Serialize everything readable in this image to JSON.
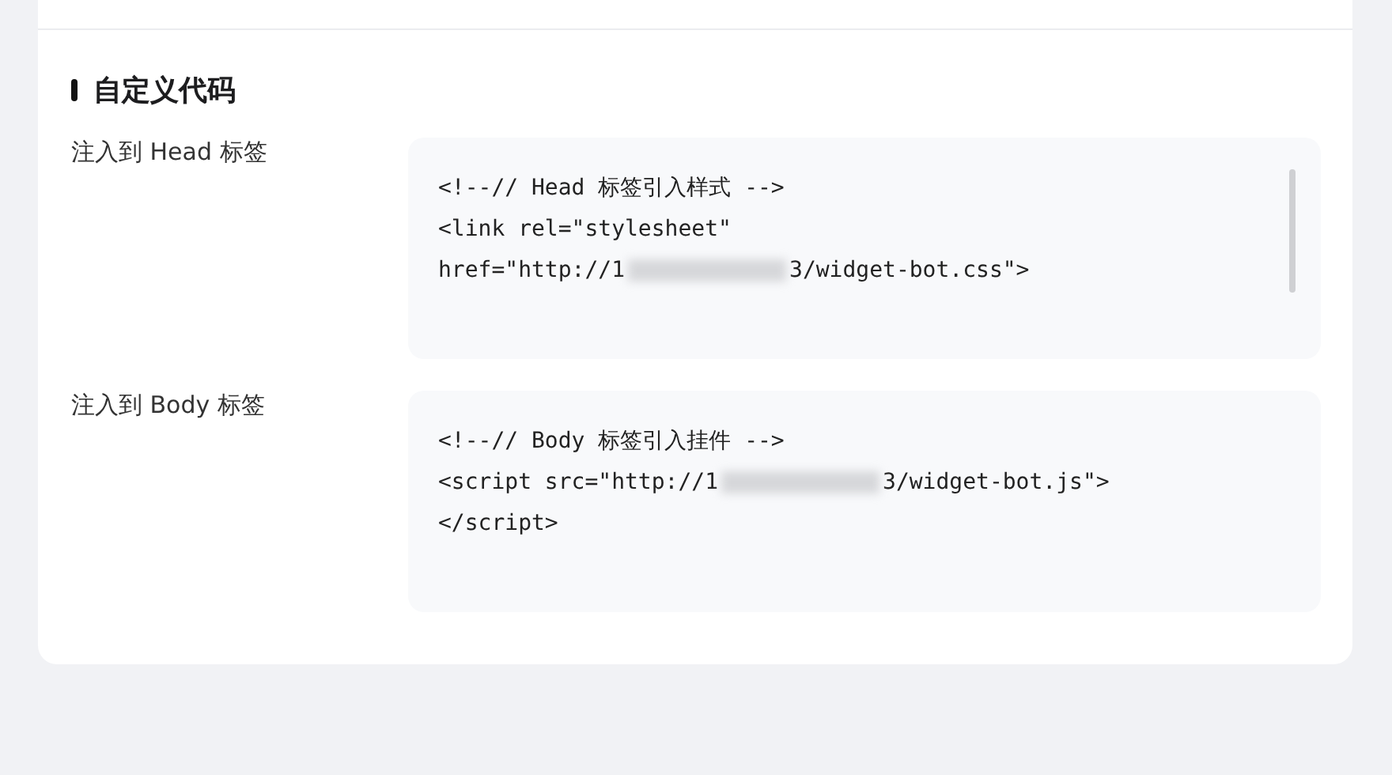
{
  "section": {
    "title": "自定义代码"
  },
  "fields": [
    {
      "label": "注入到 Head 标签",
      "scrollbar": true,
      "lines": [
        {
          "kind": "plain",
          "text": "<!--// Head 标签引入样式 -->"
        },
        {
          "kind": "plain",
          "text": "<link rel=\"stylesheet\""
        },
        {
          "kind": "redacted",
          "text": "href=\"http://1",
          "tail": "3/widget-bot.css\">"
        }
      ]
    },
    {
      "label": "注入到 Body 标签",
      "scrollbar": false,
      "lines": [
        {
          "kind": "plain",
          "text": "<!--// Body 标签引入挂件 -->"
        },
        {
          "kind": "redacted",
          "text": "<script src=\"http://1",
          "tail": "3/widget-bot.js\">"
        },
        {
          "kind": "plain",
          "text": "</script>"
        }
      ]
    }
  ]
}
